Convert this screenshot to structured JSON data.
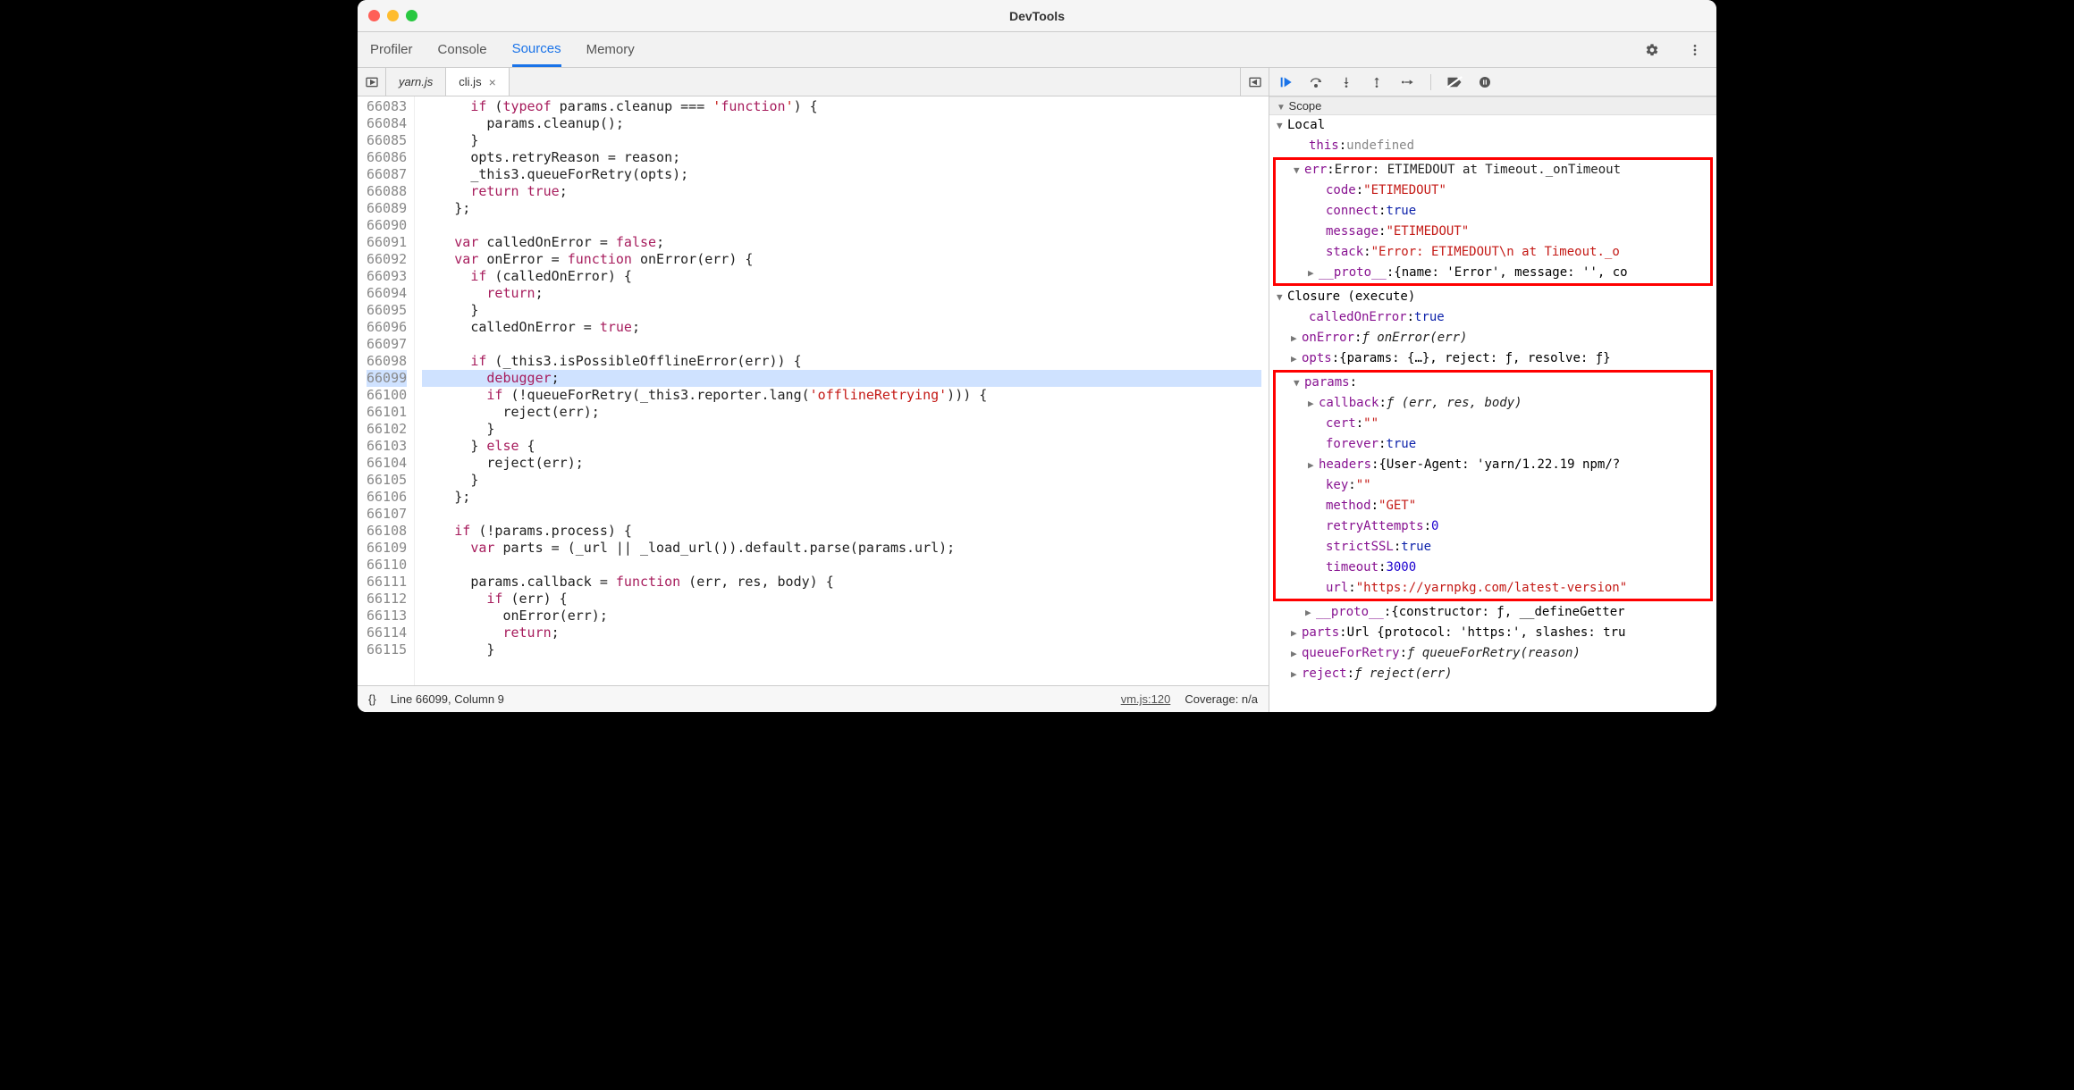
{
  "window": {
    "title": "DevTools"
  },
  "tabs": {
    "profiler": "Profiler",
    "console": "Console",
    "sources": "Sources",
    "memory": "Memory"
  },
  "file_tabs": {
    "yarn": "yarn.js",
    "cli": "cli.js"
  },
  "lines": {
    "start": 66083,
    "end": 66115
  },
  "code": [
    {
      "n": 66083,
      "t": "      if (typeof params.cleanup === 'function') {"
    },
    {
      "n": 66084,
      "t": "        params.cleanup();"
    },
    {
      "n": 66085,
      "t": "      }"
    },
    {
      "n": 66086,
      "t": "      opts.retryReason = reason;"
    },
    {
      "n": 66087,
      "t": "      _this3.queueForRetry(opts);"
    },
    {
      "n": 66088,
      "t": "      return true;"
    },
    {
      "n": 66089,
      "t": "    };"
    },
    {
      "n": 66090,
      "t": ""
    },
    {
      "n": 66091,
      "t": "    var calledOnError = false;"
    },
    {
      "n": 66092,
      "t": "    var onError = function onError(err) {"
    },
    {
      "n": 66093,
      "t": "      if (calledOnError) {"
    },
    {
      "n": 66094,
      "t": "        return;"
    },
    {
      "n": 66095,
      "t": "      }"
    },
    {
      "n": 66096,
      "t": "      calledOnError = true;"
    },
    {
      "n": 66097,
      "t": ""
    },
    {
      "n": 66098,
      "t": "      if (_this3.isPossibleOfflineError(err)) {"
    },
    {
      "n": 66099,
      "t": "        debugger;",
      "hl": true
    },
    {
      "n": 66100,
      "t": "        if (!queueForRetry(_this3.reporter.lang('offlineRetrying'))) {"
    },
    {
      "n": 66101,
      "t": "          reject(err);"
    },
    {
      "n": 66102,
      "t": "        }"
    },
    {
      "n": 66103,
      "t": "      } else {"
    },
    {
      "n": 66104,
      "t": "        reject(err);"
    },
    {
      "n": 66105,
      "t": "      }"
    },
    {
      "n": 66106,
      "t": "    };"
    },
    {
      "n": 66107,
      "t": ""
    },
    {
      "n": 66108,
      "t": "    if (!params.process) {"
    },
    {
      "n": 66109,
      "t": "      var parts = (_url || _load_url()).default.parse(params.url);"
    },
    {
      "n": 66110,
      "t": ""
    },
    {
      "n": 66111,
      "t": "      params.callback = function (err, res, body) {"
    },
    {
      "n": 66112,
      "t": "        if (err) {"
    },
    {
      "n": 66113,
      "t": "          onError(err);"
    },
    {
      "n": 66114,
      "t": "          return;"
    },
    {
      "n": 66115,
      "t": "        }"
    }
  ],
  "status": {
    "brackets": "{}",
    "position": "Line 66099, Column 9",
    "vm": "vm.js:120",
    "coverage": "Coverage: n/a"
  },
  "scope": {
    "header": "Scope",
    "local": "Local",
    "this_label": "this",
    "this_val": "undefined",
    "err": {
      "label": "err",
      "summary": "Error: ETIMEDOUT at Timeout._onTimeout",
      "code_k": "code",
      "code_v": "\"ETIMEDOUT\"",
      "connect_k": "connect",
      "connect_v": "true",
      "message_k": "message",
      "message_v": "\"ETIMEDOUT\"",
      "stack_k": "stack",
      "stack_v": "\"Error: ETIMEDOUT\\n    at Timeout._o",
      "proto_k": "__proto__",
      "proto_v": "{name: 'Error', message: '', co"
    },
    "closure": "Closure (execute)",
    "calledOnError_k": "calledOnError",
    "calledOnError_v": "true",
    "onError_k": "onError",
    "onError_v": "ƒ onError(err)",
    "opts_k": "opts",
    "opts_v": "{params: {…}, reject: ƒ, resolve: ƒ}",
    "params": {
      "label": "params",
      "callback_k": "callback",
      "callback_v": "ƒ (err, res, body)",
      "cert_k": "cert",
      "cert_v": "\"\"",
      "forever_k": "forever",
      "forever_v": "true",
      "headers_k": "headers",
      "headers_v": "{User-Agent: 'yarn/1.22.19 npm/? ",
      "key_k": "key",
      "key_v": "\"\"",
      "method_k": "method",
      "method_v": "\"GET\"",
      "retryAttempts_k": "retryAttempts",
      "retryAttempts_v": "0",
      "strictSSL_k": "strictSSL",
      "strictSSL_v": "true",
      "timeout_k": "timeout",
      "timeout_v": "3000",
      "url_k": "url",
      "url_v": "\"https://yarnpkg.com/latest-version\""
    },
    "proto2_k": "__proto__",
    "proto2_v": "{constructor: ƒ, __defineGetter",
    "parts_k": "parts",
    "parts_v": "Url {protocol: 'https:', slashes: tru",
    "queueForRetry_k": "queueForRetry",
    "queueForRetry_v": "ƒ queueForRetry(reason)",
    "reject_k": "reject",
    "reject_v": "ƒ reject(err)"
  }
}
